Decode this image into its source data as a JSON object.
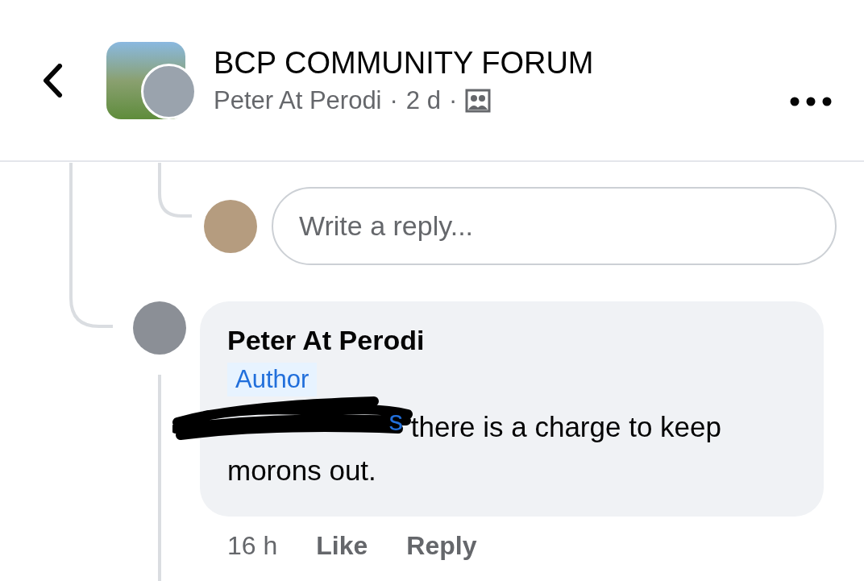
{
  "header": {
    "title": "BCP COMMUNITY FORUM",
    "meta": [
      "Peter At Perodi",
      "·",
      "2 d",
      "·"
    ]
  },
  "reply_box": {
    "placeholder": "Write a reply..."
  },
  "comment": {
    "name": "Peter At Perodi",
    "badge": "Author",
    "mention": "s",
    "text": "there is a charge to keep morons out.",
    "time": "16 h",
    "actions": [
      "Like",
      "Reply"
    ]
  }
}
